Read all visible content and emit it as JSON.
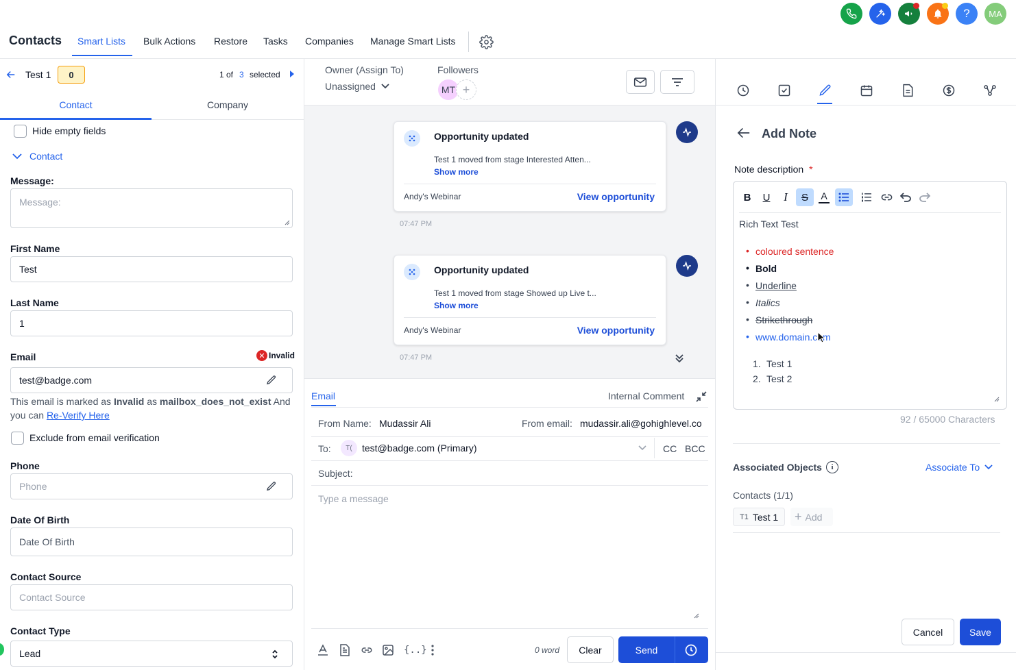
{
  "header": {
    "title": "Contacts",
    "tabs": [
      "Smart Lists",
      "Bulk Actions",
      "Restore",
      "Tasks",
      "Companies",
      "Manage Smart Lists"
    ],
    "avatar_initials": "MA",
    "help_label": "?",
    "colors": {
      "phone": "#16a34a",
      "magic": "#2563eb",
      "announce": "#15803d",
      "bell": "#f97316",
      "help": "#3b82f6",
      "avatar": "#84cc7a"
    }
  },
  "left": {
    "record_name": "Test 1",
    "badge_count": "0",
    "pager_prefix": "1 of",
    "pager_total": "3",
    "pager_suffix": "selected",
    "tabs": [
      "Contact",
      "Company"
    ],
    "hide_empty": "Hide empty fields",
    "section": "Contact",
    "message_label": "Message:",
    "message_placeholder": "Message:",
    "first_name_label": "First Name",
    "first_name_value": "Test",
    "last_name_label": "Last Name",
    "last_name_value": "1",
    "email_label": "Email",
    "invalid_label": "Invalid",
    "email_value": "test@badge.com",
    "email_warn_1": "This email is marked as",
    "email_warn_invalid": "Invalid",
    "email_warn_as": "as",
    "email_warn_reason": "mailbox_does_not_exist",
    "email_warn_and": "And",
    "email_warn_2": "you can",
    "reverify": "Re-Verify Here",
    "exclude_label": "Exclude from email verification",
    "phone_label": "Phone",
    "phone_placeholder": "Phone",
    "dob_label": "Date Of Birth",
    "dob_placeholder": "Date Of Birth",
    "source_label": "Contact Source",
    "source_placeholder": "Contact Source",
    "type_label": "Contact Type",
    "type_value": "Lead"
  },
  "middle": {
    "owner_label": "Owner (Assign To)",
    "owner_value": "Unassigned",
    "followers_label": "Followers",
    "follower_initials": "MT",
    "cards": [
      {
        "title": "Opportunity updated",
        "text": "Test 1 moved from stage Interested Atten...",
        "more": "Show more",
        "footer": "Andy's Webinar",
        "link": "View opportunity",
        "time": "07:47 PM"
      },
      {
        "title": "Opportunity updated",
        "text": "Test 1 moved from stage Showed up Live t...",
        "more": "Show more",
        "footer": "Andy's Webinar",
        "link": "View opportunity",
        "time": "07:47 PM"
      }
    ],
    "compose": {
      "tab_email": "Email",
      "tab_internal": "Internal Comment",
      "from_name_label": "From Name:",
      "from_name_value": "Mudassir Ali",
      "from_email_label": "From email:",
      "from_email_value": "mudassir.ali@gohighlevel.co",
      "to_label": "To:",
      "to_initials": "T(",
      "to_value": "test@badge.com (Primary)",
      "cc": "CC",
      "bcc": "BCC",
      "subject_label": "Subject:",
      "message_placeholder": "Type a message",
      "word_count": "0 word",
      "clear": "Clear",
      "send": "Send"
    }
  },
  "right": {
    "title": "Add Note",
    "note_label": "Note description",
    "required": "*",
    "content_heading": "Rich Text Test",
    "bullets": [
      "coloured sentence",
      "Bold",
      "Underline",
      "Italics",
      "Strikethrough",
      "www.domain.com"
    ],
    "numbered": [
      "Test 1",
      "Test 2"
    ],
    "numbers": [
      "1.",
      "2."
    ],
    "char_count": "92 / 65000 Characters",
    "associated_label": "Associated Objects",
    "associate_to": "Associate To",
    "contacts_label": "Contacts (1/1)",
    "contact_chip_initials": "T1",
    "contact_chip_name": "Test 1",
    "add": "Add",
    "cancel": "Cancel",
    "save": "Save",
    "accent": "#dc2626"
  }
}
